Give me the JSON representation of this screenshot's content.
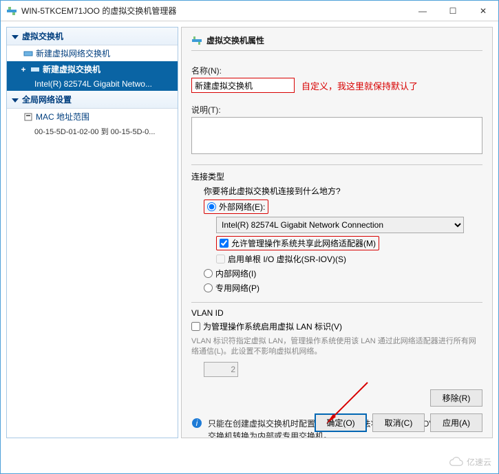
{
  "window": {
    "title": "WIN-5TKCEM71JOO 的虚拟交换机管理器",
    "min": "—",
    "max": "☐",
    "close": "✕"
  },
  "tree": {
    "vswitch_header": "虚拟交换机",
    "new_vswitch": "新建虚拟网络交换机",
    "selected_vswitch": "新建虚拟交换机",
    "selected_nic": "Intel(R) 82574L Gigabit Netwo...",
    "global_header": "全局网络设置",
    "mac_range": "MAC 地址范围",
    "mac_detail": "00-15-5D-01-02-00 到 00-15-5D-0..."
  },
  "panel": {
    "title": "虚拟交换机属性",
    "name_label": "名称(N):",
    "name_value": "新建虚拟交换机",
    "name_note": "自定义，我这里就保持默认了",
    "desc_label": "说明(T):",
    "conn": {
      "title": "连接类型",
      "question": "你要将此虚拟交换机连接到什么地方?",
      "external": "外部网络(E):",
      "nic": "Intel(R) 82574L Gigabit Network Connection",
      "allow_mgmt": "允许管理操作系统共享此网络适配器(M)",
      "sriov": "启用单根 I/O 虚拟化(SR-IOV)(S)",
      "internal": "内部网络(I)",
      "private": "专用网络(P)"
    },
    "vlan": {
      "title": "VLAN ID",
      "enable": "为管理操作系统启用虚拟 LAN 标识(V)",
      "desc": "VLAN 标识符指定虚拟 LAN，管理操作系统使用该 LAN 通过此网络适配器进行所有网络通信(L)。此设置不影响虚拟机网络。",
      "value": "2"
    },
    "remove": "移除(R)",
    "info": "只能在创建虚拟交换机时配置 SR-IOV。无法将启用了 SR-IOV 的外部虚拟交换机转换为内部或专用交换机。"
  },
  "footer": {
    "ok": "确定(O)",
    "cancel": "取消(C)",
    "apply": "应用(A)"
  },
  "watermark": "亿速云"
}
